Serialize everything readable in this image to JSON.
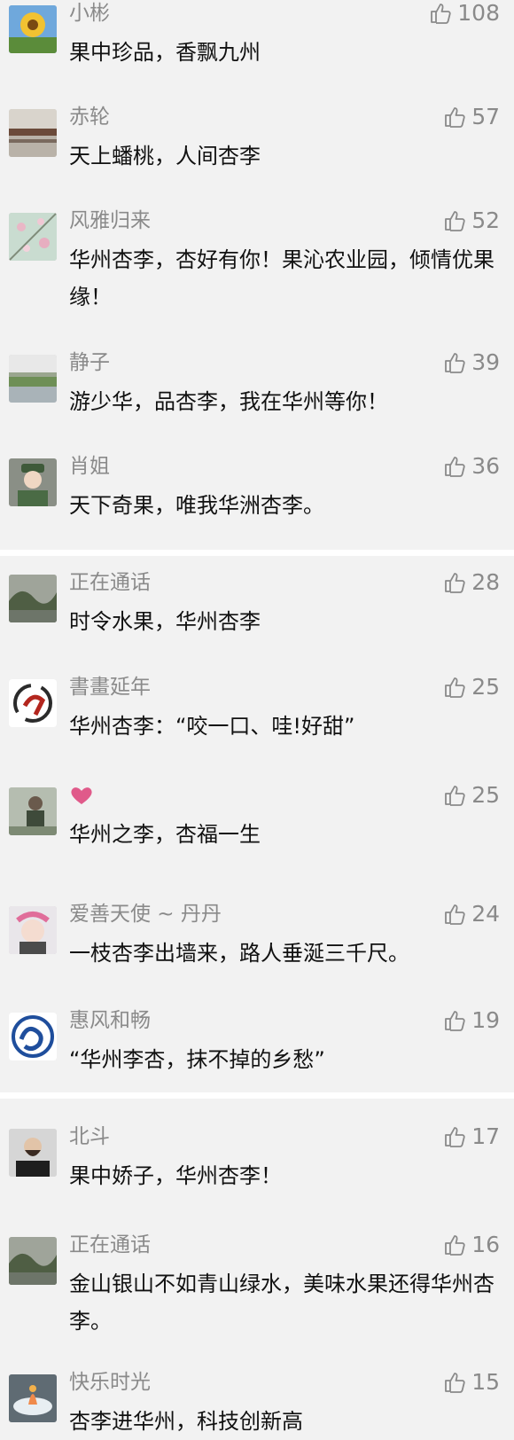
{
  "colors": {
    "background": "#f2f2f2",
    "name_text": "#8a8a8a",
    "comment_text": "#111111",
    "like_text": "#8a8a8a",
    "divider": "#ffffff",
    "heart": "#e05a8a"
  },
  "comments": [
    {
      "name": "小彬",
      "text": "果中珍品，香飘九州",
      "likes": "108",
      "avatar": "sunflower-avatar"
    },
    {
      "name": "赤轮",
      "text": "天上蟠桃，人间杏李",
      "likes": "57",
      "avatar": "lake-landscape-avatar"
    },
    {
      "name": "风雅归来",
      "text": "华州杏李，杏好有你！果沁农业园，倾情优果缘！",
      "likes": "52",
      "avatar": "blossom-avatar"
    },
    {
      "name": "静子",
      "text": "游少华，品杏李，我在华州等你！",
      "likes": "39",
      "avatar": "river-avatar"
    },
    {
      "name": "肖姐",
      "text": "天下奇果，唯我华洲杏李。",
      "likes": "36",
      "avatar": "soldier-avatar"
    },
    {
      "name": "正在通话",
      "text": "时令水果，华州杏李",
      "likes": "28",
      "avatar": "scenery-avatar"
    },
    {
      "name": "書畫延年",
      "text": "华州杏李：“咬一口、哇!好甜”",
      "likes": "25",
      "avatar": "calligraphy-avatar"
    },
    {
      "name": "",
      "text": "华州之李，杏福一生",
      "likes": "25",
      "avatar": "person-avatar",
      "name_icon": "heart-icon"
    },
    {
      "name": "爱善天使 ~ 丹丹",
      "text": "一枝杏李出墙来，路人垂涎三千尺。",
      "likes": "24",
      "avatar": "flower-crown-avatar"
    },
    {
      "name": "惠风和畅",
      "text": "“华州李杏，抹不掉的乡愁”",
      "likes": "19",
      "avatar": "dragon-logo-avatar"
    },
    {
      "name": "北斗",
      "text": "果中娇子，华州杏李！",
      "likes": "17",
      "avatar": "man-avatar"
    },
    {
      "name": "正在通话",
      "text": "金山银山不如青山绿水，美味水果还得华州杏李。",
      "likes": "16",
      "avatar": "scenery-avatar"
    },
    {
      "name": "快乐时光",
      "text": "杏李进华州，科技创新高",
      "likes": "15",
      "avatar": "dish-avatar"
    }
  ]
}
